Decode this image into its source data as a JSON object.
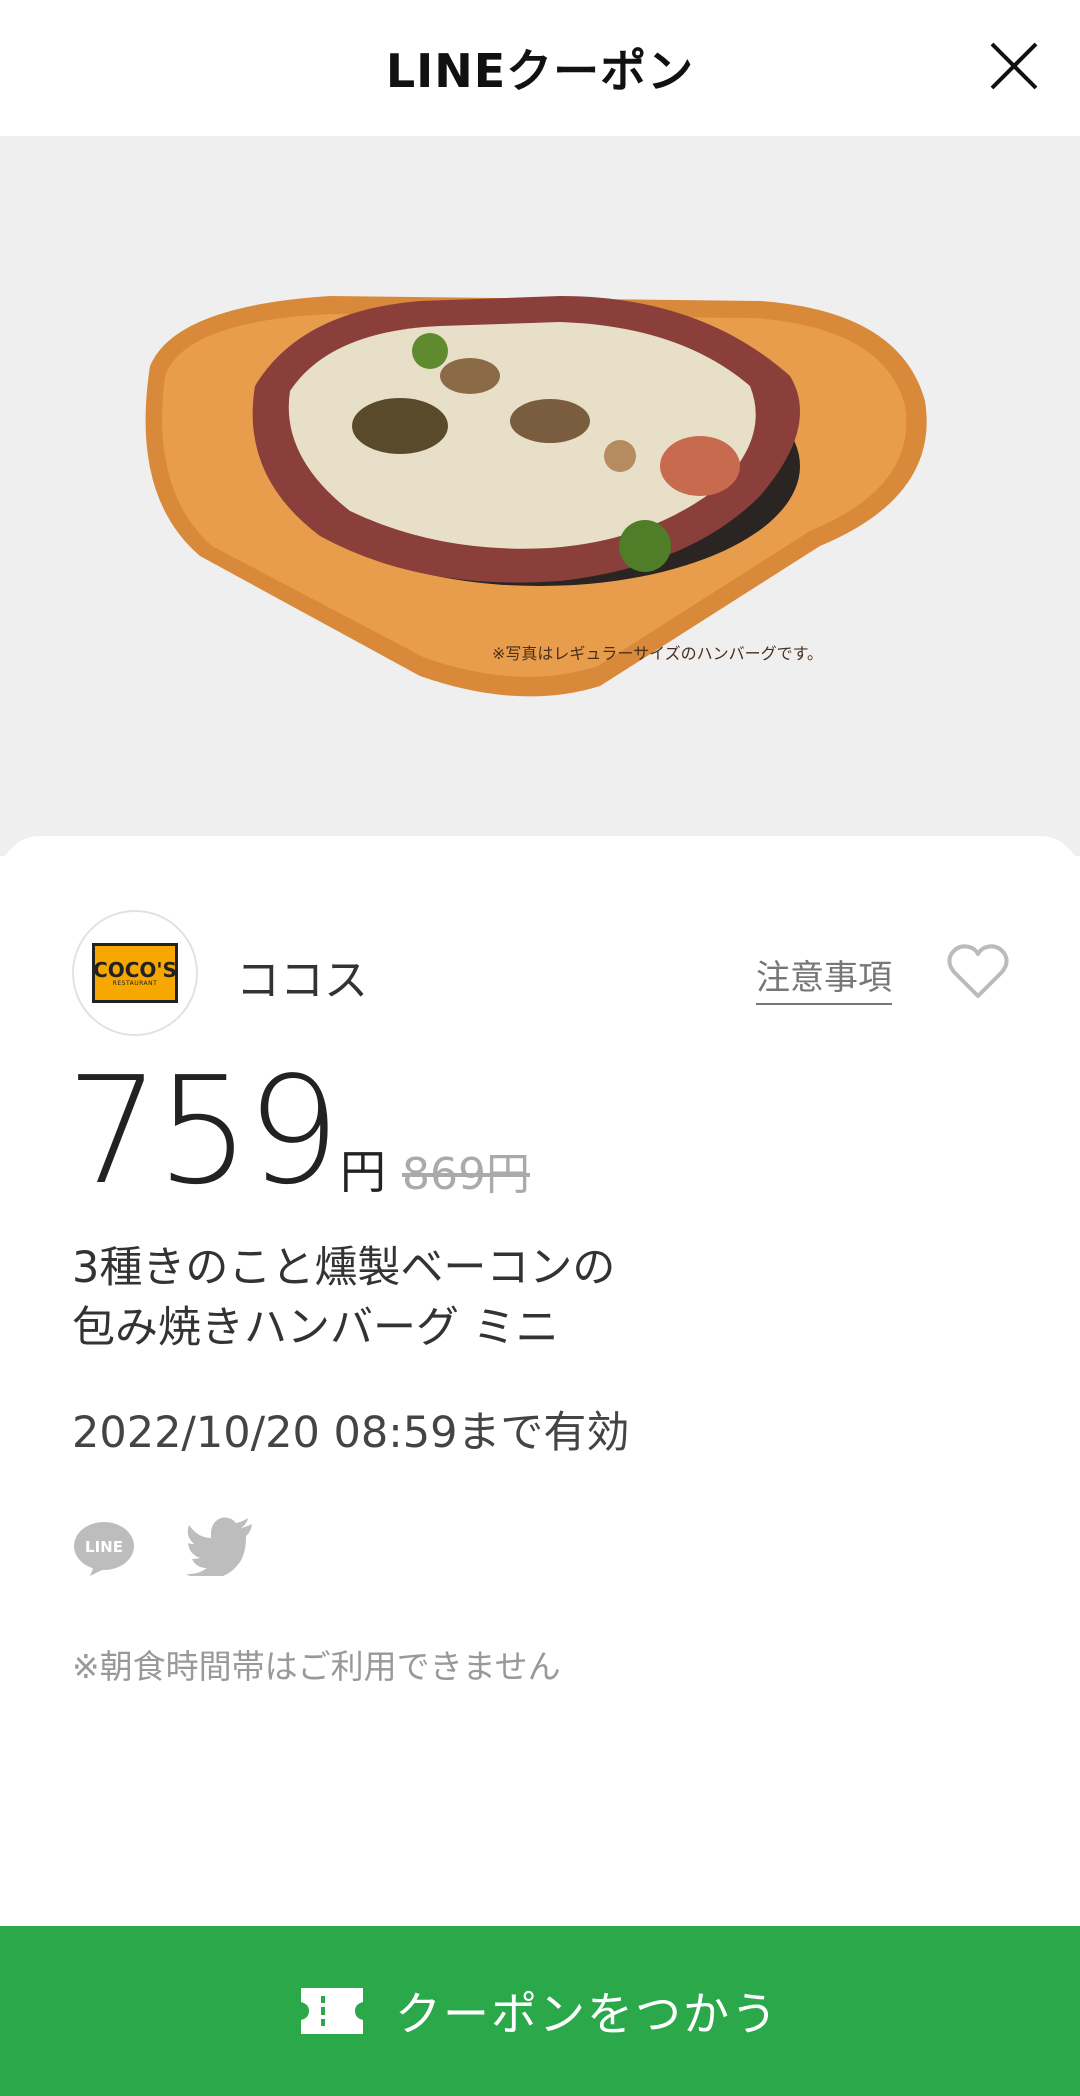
{
  "header": {
    "title": "LINEクーポン"
  },
  "hero": {
    "photo_note": "※写真はレギュラーサイズのハンバーグです。"
  },
  "store": {
    "name": "ココス",
    "logo_text": "COCO'S",
    "logo_sub": "RESTAURANT",
    "notice_label": "注意事項"
  },
  "price": {
    "discounted": "759",
    "yen": "円",
    "original": "869円"
  },
  "coupon": {
    "title_lines": [
      "3種きのこと燻製ベーコンの",
      "包み焼きハンバーグ ミニ"
    ],
    "validity": "2022/10/20  08:59まで有効",
    "note": "※朝食時間帯はご利用できません"
  },
  "share": {
    "line_label": "LINE"
  },
  "cta": {
    "label": "クーポンをつかう"
  },
  "colors": {
    "accent": "#2ba84a",
    "logo_bg": "#f6a800"
  }
}
